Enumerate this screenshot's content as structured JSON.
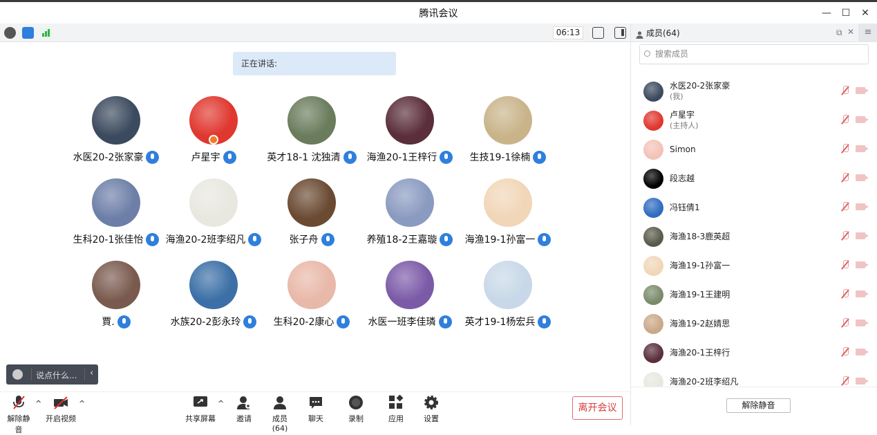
{
  "window": {
    "title": "腾讯会议"
  },
  "toolstrip": {
    "timer": "06:13"
  },
  "stage": {
    "speaking_label": "正在讲话:",
    "participants": [
      {
        "name": "水医20-2张家豪",
        "color": "#3b4a5e"
      },
      {
        "name": "卢星宇",
        "color": "#e0372f",
        "host": true
      },
      {
        "name": "英才18-1 沈独清",
        "color": "#6a7c5c"
      },
      {
        "name": "海渔20-1王梓行",
        "color": "#5a2e3a"
      },
      {
        "name": "生技19-1徐楠",
        "color": "#c9b48a"
      },
      {
        "name": "生科20-1张佳怡",
        "color": "#6d7fa8"
      },
      {
        "name": "海渔20-2班李绍凡",
        "color": "#e8e8e0"
      },
      {
        "name": "张子舟",
        "color": "#6b4a32"
      },
      {
        "name": "养殖18-2王嘉璇",
        "color": "#8a9ac0"
      },
      {
        "name": "海渔19-1孙富一",
        "color": "#f1d6b8"
      },
      {
        "name": "賈.",
        "color": "#7a5a4e"
      },
      {
        "name": "水族20-2彭永玲",
        "color": "#3b6fa6"
      },
      {
        "name": "生科20-2康心",
        "color": "#e8b8a8"
      },
      {
        "name": "水医一班李佳璘",
        "color": "#7b5aa8"
      },
      {
        "name": "英才19-1杨宏兵",
        "color": "#c8d8e8"
      }
    ],
    "chat_placeholder": "说点什么..."
  },
  "toolbar": {
    "unmute": "解除静音",
    "start_video": "开启视频",
    "share_screen": "共享屏幕",
    "invite": "邀请",
    "members": "成员(64)",
    "chat": "聊天",
    "record": "录制",
    "apps": "应用",
    "settings": "设置",
    "leave": "离开会议"
  },
  "panel": {
    "title": "成员(64)",
    "search_placeholder": "搜索成员",
    "members": [
      {
        "name": "水医20-2张家豪",
        "role": "(我)",
        "color": "#3b4a5e"
      },
      {
        "name": "卢星宇",
        "role": "(主持人)",
        "color": "#e0372f"
      },
      {
        "name": "Simon",
        "role": "",
        "color": "#f3c2b8"
      },
      {
        "name": "段志越",
        "role": "",
        "color": "#000000"
      },
      {
        "name": "冯钰倩1",
        "role": "",
        "color": "#2f6cc0"
      },
      {
        "name": "海渔18-3鹿英超",
        "role": "",
        "color": "#5a5a4a"
      },
      {
        "name": "海渔19-1孙富一",
        "role": "",
        "color": "#f1d6b8"
      },
      {
        "name": "海渔19-1王建明",
        "role": "",
        "color": "#7a8a6a"
      },
      {
        "name": "海渔19-2赵婧思",
        "role": "",
        "color": "#caa888"
      },
      {
        "name": "海渔20-1王梓行",
        "role": "",
        "color": "#5a2e3a"
      },
      {
        "name": "海渔20-2班李绍凡",
        "role": "",
        "color": "#e8e8e0"
      }
    ],
    "unmute_all": "解除静音"
  }
}
